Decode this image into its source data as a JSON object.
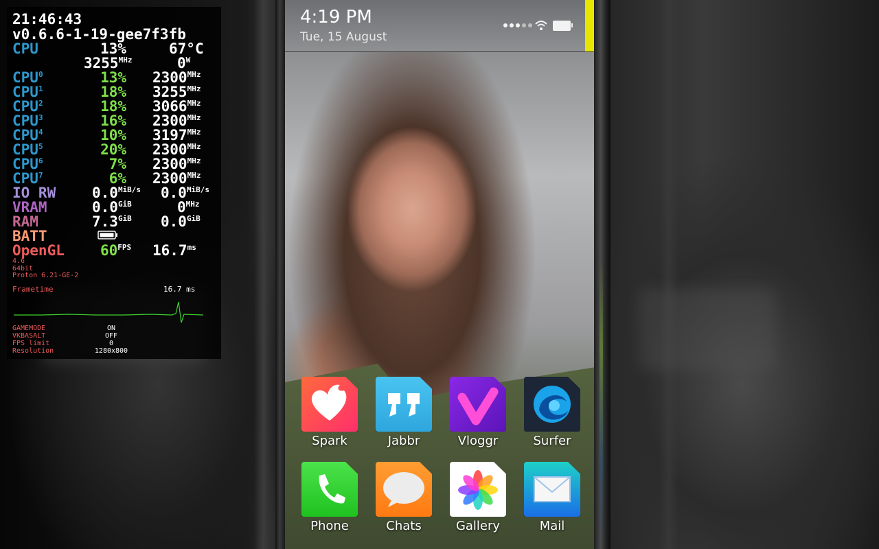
{
  "overlay": {
    "clock": "21:46:43",
    "version": "v0.6.6-1-19-gee7f3fb",
    "cpu_total": {
      "label": "CPU",
      "load": "13",
      "load_unit": "%",
      "temp": "67",
      "temp_unit": "°C",
      "freq": "3255",
      "freq_unit": "MHz",
      "power": "0",
      "power_unit": "W"
    },
    "cores": [
      {
        "label": "CPU",
        "index": "0",
        "load": "13%",
        "freq": "2300",
        "unit": "MHz"
      },
      {
        "label": "CPU",
        "index": "1",
        "load": "18%",
        "freq": "3255",
        "unit": "MHz"
      },
      {
        "label": "CPU",
        "index": "2",
        "load": "18%",
        "freq": "3066",
        "unit": "MHz"
      },
      {
        "label": "CPU",
        "index": "3",
        "load": "16%",
        "freq": "2300",
        "unit": "MHz"
      },
      {
        "label": "CPU",
        "index": "4",
        "load": "10%",
        "freq": "3197",
        "unit": "MHz"
      },
      {
        "label": "CPU",
        "index": "5",
        "load": "20%",
        "freq": "2300",
        "unit": "MHz"
      },
      {
        "label": "CPU",
        "index": "6",
        "load": "7%",
        "freq": "2300",
        "unit": "MHz"
      },
      {
        "label": "CPU",
        "index": "7",
        "load": "6%",
        "freq": "2300",
        "unit": "MHz"
      }
    ],
    "io": {
      "label": "IO RW",
      "read": "0.0",
      "read_unit": "MiB/s",
      "write": "0.0",
      "write_unit": "MiB/s"
    },
    "vram": {
      "label": "VRAM",
      "used": "0.0",
      "used_unit": "GiB",
      "clock": "0",
      "clock_unit": "MHz"
    },
    "ram": {
      "label": "RAM",
      "used": "7.3",
      "used_unit": "GiB",
      "swap": "0.0",
      "swap_unit": "GiB"
    },
    "batt": {
      "label": "BATT",
      "icon": "battery-icon"
    },
    "opengl": {
      "label": "OpenGL",
      "fps": "60",
      "fps_unit": "FPS",
      "frametime": "16.7",
      "frametime_unit": "ms"
    },
    "gl_version": "4.6",
    "arch": "64bit",
    "proton": "Proton 6.21-GE-2",
    "frametime_graph": {
      "label": "Frametime",
      "value": "16.7 ms"
    },
    "settings": [
      {
        "key": "GAMEMODE",
        "value": "ON"
      },
      {
        "key": "VKBASALT",
        "value": "OFF"
      },
      {
        "key": "FPS limit",
        "value": "0"
      },
      {
        "key": "Resolution",
        "value": "1280x800"
      }
    ]
  },
  "phone": {
    "time": "4:19 PM",
    "date": "Tue, 15 August",
    "status_icons": [
      "signal-dots-icon",
      "wifi-icon",
      "battery-icon"
    ],
    "accent": "#e6e600",
    "apps": [
      {
        "label": "Spark",
        "icon": "heart-flame-icon",
        "color": "#ff4f5e"
      },
      {
        "label": "Jabbr",
        "icon": "quote-icon",
        "color": "#39b5e8"
      },
      {
        "label": "Vloggr",
        "icon": "v-logo-icon",
        "color": "#7a1fd6"
      },
      {
        "label": "Surfer",
        "icon": "browser-swirl-icon",
        "color": "#1f2a3a"
      },
      {
        "label": "Phone",
        "icon": "phone-handset-icon",
        "color": "#2ed32e"
      },
      {
        "label": "Chats",
        "icon": "speech-bubble-icon",
        "color": "#ff8a1f"
      },
      {
        "label": "Gallery",
        "icon": "flower-petals-icon",
        "color": "#ffffff"
      },
      {
        "label": "Mail",
        "icon": "envelope-icon",
        "color": "#1a7fe8"
      }
    ]
  }
}
